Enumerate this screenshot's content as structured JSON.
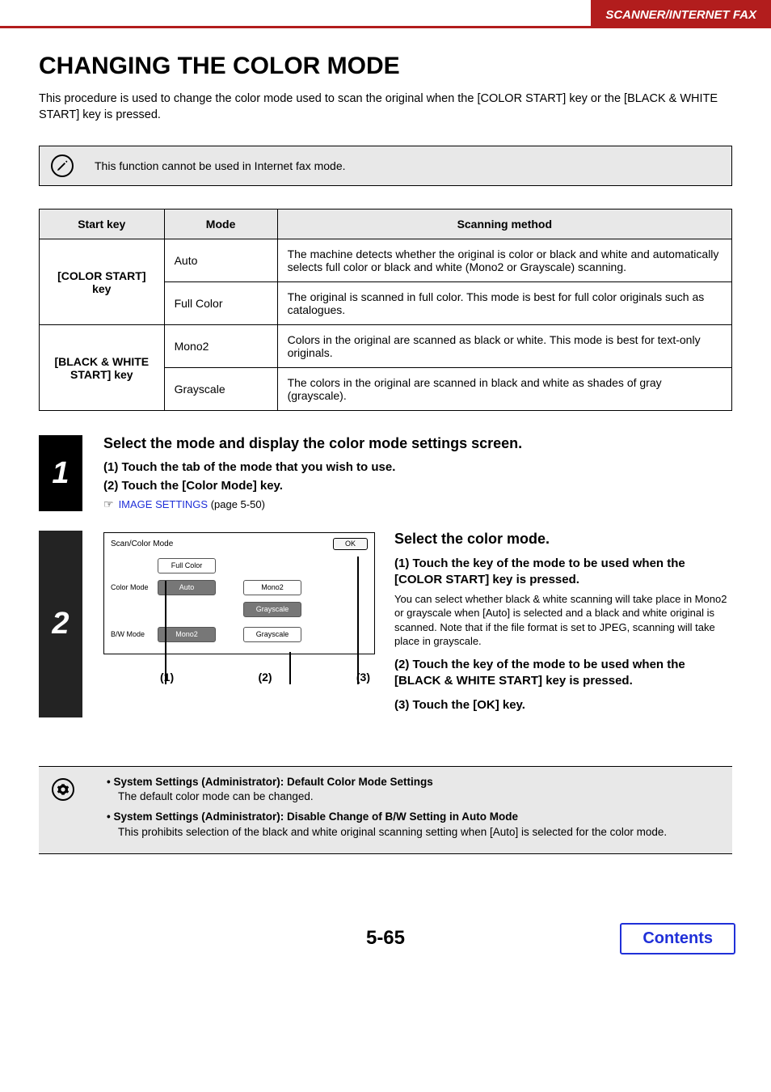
{
  "header": {
    "section": "SCANNER/INTERNET FAX"
  },
  "title": "CHANGING THE COLOR MODE",
  "intro": "This procedure is used to change the color mode used to scan the original when the [COLOR START] key or the [BLACK & WHITE START] key is pressed.",
  "note": "This function cannot be used in Internet fax mode.",
  "table": {
    "headers": [
      "Start key",
      "Mode",
      "Scanning method"
    ],
    "groups": [
      {
        "key": "[COLOR START] key",
        "rows": [
          {
            "mode": "Auto",
            "method": "The machine detects whether the original is color or black and white and automatically selects full color or black and white (Mono2 or Grayscale) scanning."
          },
          {
            "mode": "Full Color",
            "method": "The original is scanned in full color. This mode is best for full color originals such as catalogues."
          }
        ]
      },
      {
        "key": "[BLACK & WHITE START] key",
        "rows": [
          {
            "mode": "Mono2",
            "method": "Colors in the original are scanned as black or white. This mode is best for text-only originals."
          },
          {
            "mode": "Grayscale",
            "method": "The colors in the original are scanned in black and white as shades of gray (grayscale)."
          }
        ]
      }
    ]
  },
  "step1": {
    "num": "1",
    "title": "Select the mode and display the color mode settings screen.",
    "s1": "(1)  Touch the tab of the mode that you wish to use.",
    "s2": "(2)  Touch the [Color Mode] key.",
    "xref_link": "IMAGE SETTINGS",
    "xref_tail": " (page 5-50)"
  },
  "step2": {
    "num": "2",
    "title": "Select the color mode.",
    "s1": "(1)  Touch the key of the mode to be used when the [COLOR START] key is pressed.",
    "s1_note": "You can select whether black & white scanning will take place in Mono2 or grayscale when [Auto] is selected and a black and white original is scanned. Note that if the file format is set to JPEG, scanning will take place in grayscale.",
    "s2": "(2)  Touch the key of the mode to be used when the [BLACK & WHITE START] key is pressed.",
    "s3": "(3)  Touch the [OK] key.",
    "panel": {
      "header": "Scan/Color Mode",
      "ok": "OK",
      "section1_label": "Color Mode",
      "section2_label": "B/W Mode",
      "btn_fullcolor": "Full Color",
      "btn_auto": "Auto",
      "btn_mono2_a": "Mono2",
      "btn_grayscale_a": "Grayscale",
      "btn_mono2_b": "Mono2",
      "btn_grayscale_b": "Grayscale"
    },
    "callouts": {
      "c1": "(1)",
      "c2": "(2)",
      "c3": "(3)"
    }
  },
  "admin": {
    "b1_title": "System Settings (Administrator): Default Color Mode Settings",
    "b1_desc": "The default color mode can be changed.",
    "b2_title": "System Settings (Administrator): Disable Change of B/W Setting in Auto Mode",
    "b2_desc": "This prohibits selection of the black and white original scanning setting when [Auto] is selected for the color mode."
  },
  "footer": {
    "page": "5-65",
    "contents": "Contents"
  }
}
